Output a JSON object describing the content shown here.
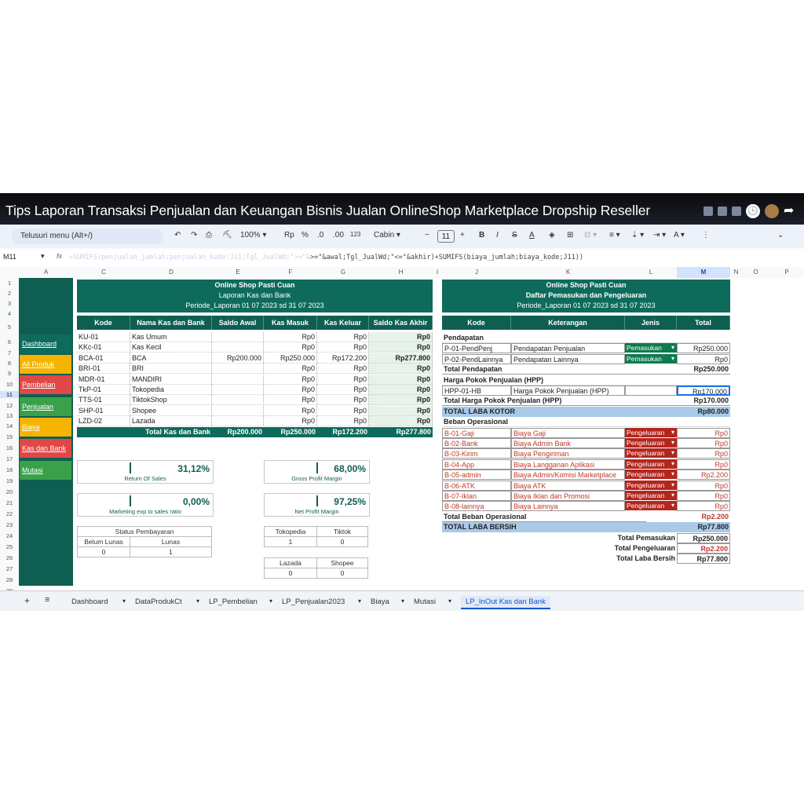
{
  "video_title": "Tips Laporan Transaksi Penjualan dan Keuangan Bisnis Jualan OnlineShop Marketplace Dropship Reseller",
  "toolbar": {
    "menu_search": "Telusuri menu (Alt+/)",
    "zoom": "100%",
    "currency": "Rp",
    "percent": "%",
    "dec_less": ".0",
    "dec_more": ".00",
    "number_format": "123",
    "font": "Cabin",
    "font_size": "11"
  },
  "formula_bar": {
    "cell_ref": "M11",
    "fx": "fx",
    "formula_blurred": "=SUMIFS(penjualan_jumlah;penjualan_kode;J11;Tgl_JualWd;\">=\"&",
    "f1": ">=\"&awal;Tgl_JualWd;\"<=\"&akhir)+SUMIFS(biaya_jumlah;biaya_kode;J11))"
  },
  "columns": [
    "A",
    "C",
    "D",
    "E",
    "F",
    "G",
    "H",
    "I",
    "J",
    "K",
    "L",
    "M",
    "N",
    "O",
    "P"
  ],
  "rows": [
    "1",
    "2",
    "3",
    "4",
    "5",
    "6",
    "7",
    "8",
    "9",
    "10",
    "11",
    "12",
    "13",
    "14",
    "15",
    "16",
    "17",
    "18",
    "19",
    "20",
    "21",
    "22",
    "23",
    "24",
    "25",
    "26",
    "27",
    "28",
    "29"
  ],
  "nav": [
    "Dashboard",
    "All Produk",
    "Pembelian",
    "Penjualan",
    "Biaya",
    "Kas dan Bank",
    "Mutasi"
  ],
  "kas": {
    "title1": "Online Shop Pasti Cuan",
    "title2": "Laporan Kas dan Bank",
    "title3": "Periode_Laporan 01 07 2023 sd 31 07 2023",
    "headers": [
      "Kode",
      "Nama Kas dan Bank",
      "Saldo Awal",
      "Kas Masuk",
      "Kas Keluar",
      "Saldo Kas Akhir"
    ],
    "rows": [
      [
        "KU-01",
        "Kas Umum",
        "",
        "Rp0",
        "Rp0",
        "Rp0"
      ],
      [
        "KKc-01",
        "Kas Kecil",
        "",
        "Rp0",
        "Rp0",
        "Rp0"
      ],
      [
        "BCA-01",
        "BCA",
        "Rp200.000",
        "Rp250.000",
        "Rp172.200",
        "Rp277.800"
      ],
      [
        "BRI-01",
        "BRI",
        "",
        "Rp0",
        "Rp0",
        "Rp0"
      ],
      [
        "MDR-01",
        "MANDIRI",
        "",
        "Rp0",
        "Rp0",
        "Rp0"
      ],
      [
        "TkP-01",
        "Tokopedia",
        "",
        "Rp0",
        "Rp0",
        "Rp0"
      ],
      [
        "TTS-01",
        "TiktokShop",
        "",
        "Rp0",
        "Rp0",
        "Rp0"
      ],
      [
        "SHP-01",
        "Shopee",
        "",
        "Rp0",
        "Rp0",
        "Rp0"
      ],
      [
        "LZD-02",
        "Lazada",
        "",
        "Rp0",
        "Rp0",
        "Rp0"
      ]
    ],
    "total": [
      "Total Kas dan Bank",
      "Rp200.000",
      "Rp250.000",
      "Rp172.200",
      "Rp277.800"
    ]
  },
  "metrics": [
    {
      "value": "31,12%",
      "label": "Return Of Sales"
    },
    {
      "value": "68,00%",
      "label": "Gross Profit Margin"
    },
    {
      "value": "0,00%",
      "label": "Marketing exp to sales ratio"
    },
    {
      "value": "97,25%",
      "label": "Net Profit Margin"
    }
  ],
  "status": {
    "title": "Status Pembayaran",
    "h1": "Belum Lunas",
    "h2": "Lunas",
    "v1": "0",
    "v2": "1"
  },
  "channels": [
    {
      "h1": "Tokopedia",
      "h2": "Tiktok",
      "v1": "1",
      "v2": "0"
    },
    {
      "h1": "Lazada",
      "h2": "Shopee",
      "v1": "0",
      "v2": "0"
    }
  ],
  "pl": {
    "title1": "Online Shop Pasti Cuan",
    "title2": "Daftar Pemasukan dan Pengeluaran",
    "title3": "Periode_Laporan 01 07 2023 sd 31 07 2023",
    "headers": [
      "Kode",
      "Keterangan",
      "Jenis",
      "Total"
    ],
    "sec_pendapatan": "Pendapatan",
    "pendapatan": [
      [
        "P-01-PendPenj",
        "Pendapatan Penjualan",
        "Pemasukan",
        "Rp250.000"
      ],
      [
        "P-02-PendLainnya",
        "Pendapatan Lainnya",
        "Pemasukan",
        "Rp0"
      ]
    ],
    "total_pendapatan": [
      "Total Pendapatan",
      "Rp250.000"
    ],
    "sec_hpp": "Harga Pokok Penjualan (HPP)",
    "hpp": [
      "HPP-01-HB",
      "Harga Pokok Penjualan (HPP)",
      "",
      "Rp170.000"
    ],
    "total_hpp": [
      "Total Harga Pokok Penjualan (HPP)",
      "Rp170.000"
    ],
    "laba_kotor": [
      "TOTAL LABA KOTOR",
      "Rp80.000"
    ],
    "sec_beban": "Beban Operasional",
    "beban": [
      [
        "B-01-Gaji",
        "Biaya Gaji",
        "Pengeluaran",
        "Rp0"
      ],
      [
        "B-02-Bank",
        "Biaya Admin Bank",
        "Pengeluaran",
        "Rp0"
      ],
      [
        "B-03-Kirim",
        "Biaya Pengiriman",
        "Pengeluaran",
        "Rp0"
      ],
      [
        "B-04-App",
        "Biaya Langganan Aplikasi",
        "Pengeluaran",
        "Rp0"
      ],
      [
        "B-05-admin",
        "Biaya Admin/Komisi Marketplace",
        "Pengeluaran",
        "Rp2.200"
      ],
      [
        "B-06-ATK",
        "Biaya ATK",
        "Pengeluaran",
        "Rp0"
      ],
      [
        "B-07-Iklan",
        "Biaya Iklan dan Promosi",
        "Pengeluaran",
        "Rp0"
      ],
      [
        "B-08-lainnya",
        "Biaya Lainnya",
        "Pengeluaran",
        "Rp0"
      ]
    ],
    "total_beban": [
      "Total Beban Operasional",
      "Rp2.200"
    ],
    "laba_bersih": [
      "TOTAL LABA BERSIH",
      "Rp77.800"
    ],
    "summary": [
      [
        "Total Pemasukan",
        "Rp250.000"
      ],
      [
        "Total Pengeluaran",
        "Rp2.200"
      ],
      [
        "Total Laba Bersih",
        "Rp77.800"
      ]
    ]
  },
  "sheet_tabs": [
    "Dashboard",
    "DataProdukCt",
    "LP_Pembelian",
    "LP_Penjualan2023",
    "Biaya",
    "Mutasi",
    "LP_InOut Kas dan Bank"
  ],
  "colors": {
    "teal": "#0e5f52",
    "green_btn": "#0f7a4d",
    "red_btn": "#b3261e",
    "highlight": "#a9c9e8",
    "nav_yellow": "#f5b400",
    "nav_red": "#e04848",
    "nav_green": "#3aa14a"
  }
}
